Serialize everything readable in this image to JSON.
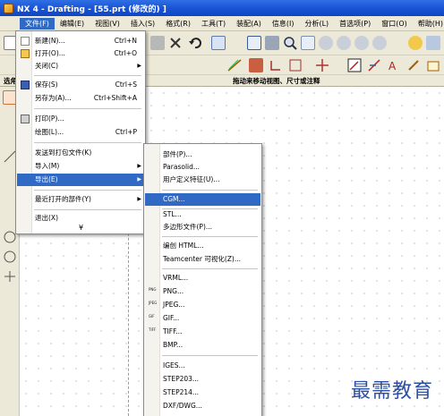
{
  "window": {
    "title": "NX 4 - Drafting - [55.prt  (修改的) ]"
  },
  "menubar": {
    "items": [
      {
        "id": "file",
        "label": "文件(F)"
      },
      {
        "id": "edit",
        "label": "编辑(E)"
      },
      {
        "id": "view",
        "label": "视图(V)"
      },
      {
        "id": "insert",
        "label": "插入(S)"
      },
      {
        "id": "format",
        "label": "格式(R)"
      },
      {
        "id": "tools",
        "label": "工具(T)"
      },
      {
        "id": "assembly",
        "label": "装配(A)"
      },
      {
        "id": "info",
        "label": "信息(I)"
      },
      {
        "id": "analysis",
        "label": "分析(L)"
      },
      {
        "id": "prefs",
        "label": "首选项(P)"
      },
      {
        "id": "window",
        "label": "窗口(O)"
      },
      {
        "id": "help",
        "label": "帮助(H)"
      }
    ]
  },
  "cue_line": {
    "left": "选角",
    "text": "拖动来移动视图、尺寸或注释"
  },
  "file_menu": {
    "items": [
      {
        "label": "新建(N)...",
        "shortcut": "Ctrl+N",
        "icon": "new-file-icon"
      },
      {
        "label": "打开(O)...",
        "shortcut": "Ctrl+O",
        "icon": "open-folder-icon"
      },
      {
        "label": "关闭(C)",
        "submenu": true
      },
      {
        "label": "保存(S)",
        "shortcut": "Ctrl+S",
        "icon": "save-icon"
      },
      {
        "label": "另存为(A)...",
        "shortcut": "Ctrl+Shift+A"
      },
      {
        "label": "打印(P)...",
        "icon": "print-icon"
      },
      {
        "label": "绘图(L)...",
        "shortcut": "Ctrl+P"
      },
      {
        "label": "发送到打包文件(K)"
      },
      {
        "label": "导入(M)",
        "submenu": true
      },
      {
        "label": "导出(E)",
        "submenu": true,
        "highlighted": true
      },
      {
        "label": "最近打开的部件(Y)",
        "submenu": true
      },
      {
        "label": "退出(X)"
      }
    ],
    "expand": "¥"
  },
  "export_menu": {
    "items": [
      {
        "label": "部件(P)..."
      },
      {
        "label": "Parasolid..."
      },
      {
        "label": "用户定义特征(U)..."
      },
      {
        "label": "CGM...",
        "highlighted": true
      },
      {
        "label": "STL..."
      },
      {
        "label": "多边形文件(P)..."
      },
      {
        "label": "编创 HTML..."
      },
      {
        "label": "Teamcenter 可视化(Z)..."
      },
      {
        "label": "VRML..."
      },
      {
        "label": "PNG...",
        "icon": "png-icon",
        "icon_text": "PNG"
      },
      {
        "label": "JPEG...",
        "icon": "jpeg-icon",
        "icon_text": "JPEG"
      },
      {
        "label": "GIF...",
        "icon": "gif-icon",
        "icon_text": "GIF"
      },
      {
        "label": "TIFF...",
        "icon": "tiff-icon",
        "icon_text": "TIFF"
      },
      {
        "label": "BMP..."
      },
      {
        "label": "IGES..."
      },
      {
        "label": "STEP203..."
      },
      {
        "label": "STEP214..."
      },
      {
        "label": "DXF/DWG..."
      }
    ]
  },
  "watermark": {
    "text": "最需教育"
  },
  "colors": {
    "title": "#1a55d6",
    "highlight": "#316ac5",
    "chrome": "#ece9d8"
  }
}
